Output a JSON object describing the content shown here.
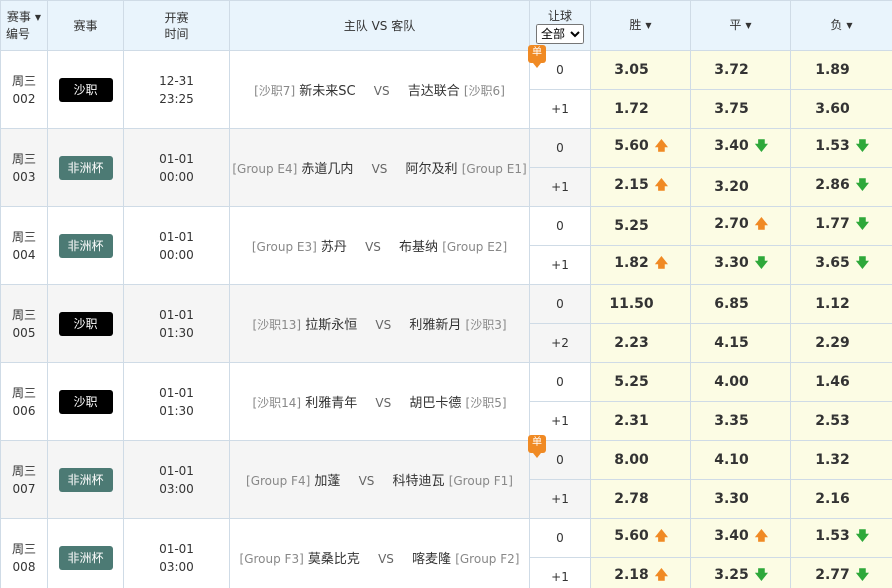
{
  "header": {
    "col_id_l1": "赛事",
    "col_id_l2": "编号",
    "col_league": "赛事",
    "col_time_l1": "开赛",
    "col_time_l2": "时间",
    "col_match": "主队 VS 客队",
    "col_hcp": "让球",
    "hcp_select": "全部",
    "col_win": "胜",
    "col_draw": "平",
    "col_lose": "负"
  },
  "vs_text": "VS",
  "single_label": "单",
  "colors": {
    "league_saudi": "#000000",
    "league_afcon": "#4c7a74",
    "odds_bg": "#fcfce4",
    "header_bg": "#e9f4fc",
    "up": "#f08a24",
    "down": "#2ea83a"
  },
  "matches": [
    {
      "week": "周三",
      "num": "002",
      "league": "沙职",
      "league_type": "saudi",
      "date": "12-31",
      "time": "23:25",
      "home_tag": "[沙职7]",
      "home": "新未来SC",
      "away": "吉达联合",
      "away_tag": "[沙职6]",
      "single": true,
      "lines": [
        {
          "hcp": "0",
          "win": "3.05",
          "win_t": "",
          "draw": "3.72",
          "draw_t": "",
          "lose": "1.89",
          "lose_t": ""
        },
        {
          "hcp": "+1",
          "win": "1.72",
          "win_t": "",
          "draw": "3.75",
          "draw_t": "",
          "lose": "3.60",
          "lose_t": ""
        }
      ]
    },
    {
      "week": "周三",
      "num": "003",
      "league": "非洲杯",
      "league_type": "afcon",
      "date": "01-01",
      "time": "00:00",
      "home_tag": "[Group E4]",
      "home": "赤道几内",
      "away": "阿尔及利",
      "away_tag": "[Group E1]",
      "single": false,
      "lines": [
        {
          "hcp": "0",
          "win": "5.60",
          "win_t": "up",
          "draw": "3.40",
          "draw_t": "down",
          "lose": "1.53",
          "lose_t": "down"
        },
        {
          "hcp": "+1",
          "win": "2.15",
          "win_t": "up",
          "draw": "3.20",
          "draw_t": "",
          "lose": "2.86",
          "lose_t": "down"
        }
      ]
    },
    {
      "week": "周三",
      "num": "004",
      "league": "非洲杯",
      "league_type": "afcon",
      "date": "01-01",
      "time": "00:00",
      "home_tag": "[Group E3]",
      "home": "苏丹",
      "away": "布基纳",
      "away_tag": "[Group E2]",
      "single": false,
      "lines": [
        {
          "hcp": "0",
          "win": "5.25",
          "win_t": "",
          "draw": "2.70",
          "draw_t": "up",
          "lose": "1.77",
          "lose_t": "down"
        },
        {
          "hcp": "+1",
          "win": "1.82",
          "win_t": "up",
          "draw": "3.30",
          "draw_t": "down",
          "lose": "3.65",
          "lose_t": "down"
        }
      ]
    },
    {
      "week": "周三",
      "num": "005",
      "league": "沙职",
      "league_type": "saudi",
      "date": "01-01",
      "time": "01:30",
      "home_tag": "[沙职13]",
      "home": "拉斯永恒",
      "away": "利雅新月",
      "away_tag": "[沙职3]",
      "single": false,
      "lines": [
        {
          "hcp": "0",
          "win": "11.50",
          "win_t": "",
          "draw": "6.85",
          "draw_t": "",
          "lose": "1.12",
          "lose_t": ""
        },
        {
          "hcp": "+2",
          "win": "2.23",
          "win_t": "",
          "draw": "4.15",
          "draw_t": "",
          "lose": "2.29",
          "lose_t": ""
        }
      ]
    },
    {
      "week": "周三",
      "num": "006",
      "league": "沙职",
      "league_type": "saudi",
      "date": "01-01",
      "time": "01:30",
      "home_tag": "[沙职14]",
      "home": "利雅青年",
      "away": "胡巴卡德",
      "away_tag": "[沙职5]",
      "single": false,
      "lines": [
        {
          "hcp": "0",
          "win": "5.25",
          "win_t": "",
          "draw": "4.00",
          "draw_t": "",
          "lose": "1.46",
          "lose_t": ""
        },
        {
          "hcp": "+1",
          "win": "2.31",
          "win_t": "",
          "draw": "3.35",
          "draw_t": "",
          "lose": "2.53",
          "lose_t": ""
        }
      ]
    },
    {
      "week": "周三",
      "num": "007",
      "league": "非洲杯",
      "league_type": "afcon",
      "date": "01-01",
      "time": "03:00",
      "home_tag": "[Group F4]",
      "home": "加蓬",
      "away": "科特迪瓦",
      "away_tag": "[Group F1]",
      "single": true,
      "lines": [
        {
          "hcp": "0",
          "win": "8.00",
          "win_t": "",
          "draw": "4.10",
          "draw_t": "",
          "lose": "1.32",
          "lose_t": ""
        },
        {
          "hcp": "+1",
          "win": "2.78",
          "win_t": "",
          "draw": "3.30",
          "draw_t": "",
          "lose": "2.16",
          "lose_t": ""
        }
      ]
    },
    {
      "week": "周三",
      "num": "008",
      "league": "非洲杯",
      "league_type": "afcon",
      "date": "01-01",
      "time": "03:00",
      "home_tag": "[Group F3]",
      "home": "莫桑比克",
      "away": "喀麦隆",
      "away_tag": "[Group F2]",
      "single": false,
      "lines": [
        {
          "hcp": "0",
          "win": "5.60",
          "win_t": "up",
          "draw": "3.40",
          "draw_t": "up",
          "lose": "1.53",
          "lose_t": "down"
        },
        {
          "hcp": "+1",
          "win": "2.18",
          "win_t": "up",
          "draw": "3.25",
          "draw_t": "down",
          "lose": "2.77",
          "lose_t": "down"
        }
      ]
    }
  ]
}
